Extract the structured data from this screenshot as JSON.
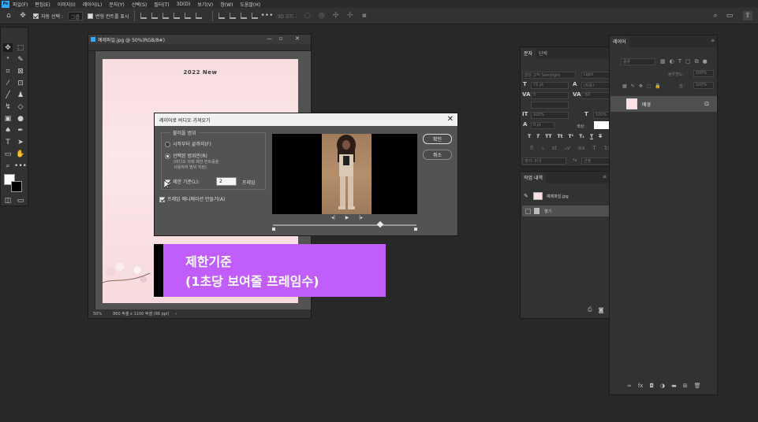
{
  "menubar": {
    "app": "Ps",
    "items": [
      "파일(F)",
      "편집(E)",
      "이미지(I)",
      "레이어(L)",
      "문자(Y)",
      "선택(S)",
      "필터(T)",
      "3D(D)",
      "보기(V)",
      "창(W)",
      "도움말(H)"
    ]
  },
  "options": {
    "auto_select_label": "자동 선택 :",
    "auto_select_value": "그룹",
    "transform_controls_label": "변형 컨트롤 표시",
    "mode_3d_label": "3D 모드 :"
  },
  "document": {
    "title": "예제파일.jpg @ 50%(RGB/8#)",
    "canvas_text": "2022 New",
    "zoom": "50%",
    "size_info": "860 픽셀 x 1100 픽셀 (96 ppi)"
  },
  "dialog": {
    "title": "레이어로 비디오 가져오기",
    "range_legend": "불러올 범위",
    "from_start_label": "시작부터 끝까지(F)",
    "selected_range_label": "선택된 범위만(R)",
    "selected_range_hint_1": "(비디오 아래 제한 컨트롤을",
    "selected_range_hint_2": "사용하여 범위 지정)",
    "limit_label": "제한 기준(L):",
    "limit_value": "2",
    "limit_unit": "프레임",
    "frame_anim_label": "프레임 애니메이션 만들기(A)",
    "ok_label": "확인",
    "cancel_label": "취소"
  },
  "banner": {
    "line1": "제한기준",
    "line2": "(1초당 보여줄 프레임수)"
  },
  "char_panel": {
    "tab_character": "문자",
    "tab_paragraph": "단락",
    "font_family": "맑은 고딕 Semilight",
    "font_style": "Light",
    "font_size": "72 pt",
    "leading": "(자동)",
    "kerning": "0",
    "tracking": "-50",
    "scale_v": "100%",
    "scale_h": "100%",
    "baseline": "0 pt",
    "color_label": "색상:",
    "language": "영어: 미국",
    "antialias": "선명"
  },
  "history_panel": {
    "title": "작업 내역",
    "items": [
      "예제파일.jpg",
      "열기"
    ]
  },
  "layers_panel": {
    "title": "레이어",
    "kind_filter": "종류",
    "opacity_label": "불투명도:",
    "opacity_value": "100%",
    "fill_label": "칠:",
    "fill_value": "100%",
    "layer_name": "배경"
  }
}
